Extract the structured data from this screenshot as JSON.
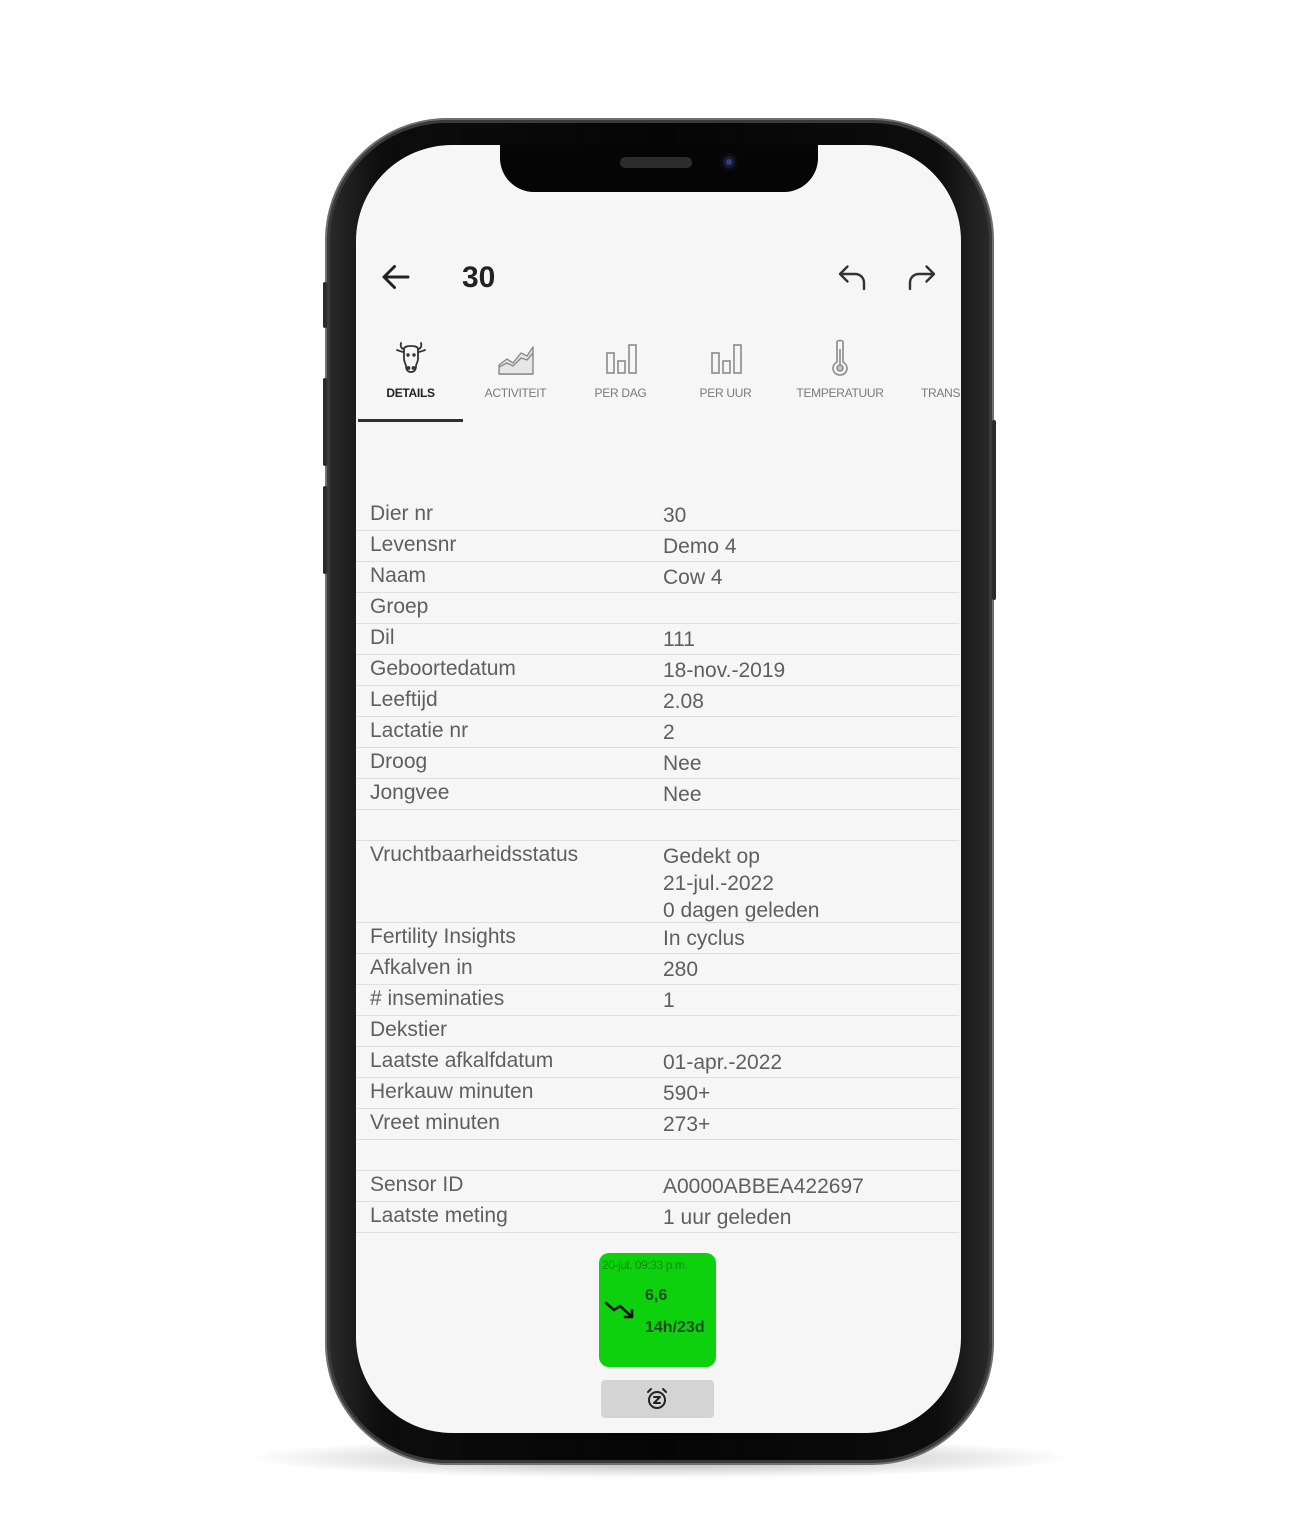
{
  "header": {
    "title": "30",
    "icons": {
      "back": "arrow-left-icon",
      "undo": "undo-icon",
      "redo": "redo-icon"
    }
  },
  "tabs": [
    {
      "label": "DETAILS",
      "icon": "cow-icon",
      "active": true
    },
    {
      "label": "ACTIVITEIT",
      "icon": "area-chart-icon",
      "active": false
    },
    {
      "label": "PER DAG",
      "icon": "bar-chart-icon",
      "active": false
    },
    {
      "label": "PER UUR",
      "icon": "bar-chart-icon",
      "active": false
    },
    {
      "label": "TEMPERATUUR",
      "icon": "thermometer-icon",
      "active": false
    },
    {
      "label": "TRANS",
      "icon": "",
      "active": false
    }
  ],
  "details": {
    "rows": [
      {
        "label": "Dier nr",
        "value": [
          "30"
        ]
      },
      {
        "label": "Levensnr",
        "value": [
          "Demo 4"
        ]
      },
      {
        "label": "Naam",
        "value": [
          "Cow 4"
        ]
      },
      {
        "label": "Groep",
        "value": []
      },
      {
        "label": "Dil",
        "value": [
          "111"
        ]
      },
      {
        "label": "Geboortedatum",
        "value": [
          "18-nov.-2019"
        ]
      },
      {
        "label": "Leeftijd",
        "value": [
          "2.08"
        ]
      },
      {
        "label": "Lactatie nr",
        "value": [
          "2"
        ]
      },
      {
        "label": "Droog",
        "value": [
          "Nee"
        ]
      },
      {
        "label": "Jongvee",
        "value": [
          "Nee"
        ]
      },
      {
        "label": "",
        "value": []
      },
      {
        "label": "Vruchtbaarheidsstatus",
        "value": [
          "Gedekt op",
          "21-jul.-2022",
          "0 dagen geleden"
        ]
      },
      {
        "label": "Fertility Insights",
        "value": [
          "In cyclus"
        ]
      },
      {
        "label": "Afkalven in",
        "value": [
          "280"
        ]
      },
      {
        "label": "# inseminaties",
        "value": [
          "1"
        ]
      },
      {
        "label": "Dekstier",
        "value": []
      },
      {
        "label": "Laatste afkalfdatum",
        "value": [
          "01-apr.-2022"
        ]
      },
      {
        "label": "Herkauw minuten",
        "value": [
          "590+"
        ]
      },
      {
        "label": "Vreet minuten",
        "value": [
          "273+"
        ]
      },
      {
        "label": "",
        "value": []
      },
      {
        "label": "Sensor ID",
        "value": [
          "A0000ABBEA422697"
        ]
      },
      {
        "label": "Laatste meting",
        "value": [
          "1 uur geleden"
        ]
      }
    ]
  },
  "sensor_tile": {
    "date": "20-jul. 09:33 p.m.",
    "value": "6,6",
    "days": "14h/23d",
    "trend_icon": "trend-down-icon",
    "color": "#0dd10d"
  },
  "snooze": {
    "icon": "snooze-alarm-icon"
  },
  "colors": {
    "screen_bg": "#f6f6f6",
    "text": "#5f5f5f",
    "divider": "#dedede",
    "tile_green": "#0dd10d"
  }
}
